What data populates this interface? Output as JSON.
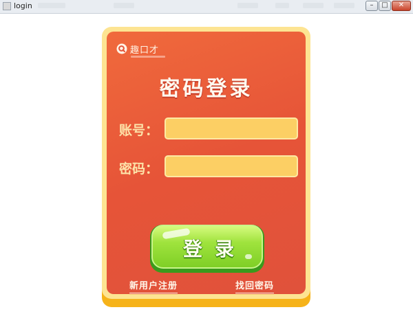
{
  "window": {
    "title": "login",
    "minimize_glyph": "–",
    "maximize_glyph": "□",
    "close_glyph": "✕"
  },
  "brand": {
    "name": "趣口才",
    "icon": "q-logo-icon",
    "color": "#e64a2e"
  },
  "form": {
    "heading": "密码登录",
    "account_label": "账号：",
    "account_value": "",
    "password_label": "密码：",
    "password_value": "",
    "login_button": "登录"
  },
  "links": {
    "register": "新用户注册",
    "forgot_password": "找回密码"
  },
  "colors": {
    "card_bg": "#e65438",
    "card_border": "#fde492",
    "input_bg": "#fccf64",
    "button_green": "#9fe33d"
  }
}
